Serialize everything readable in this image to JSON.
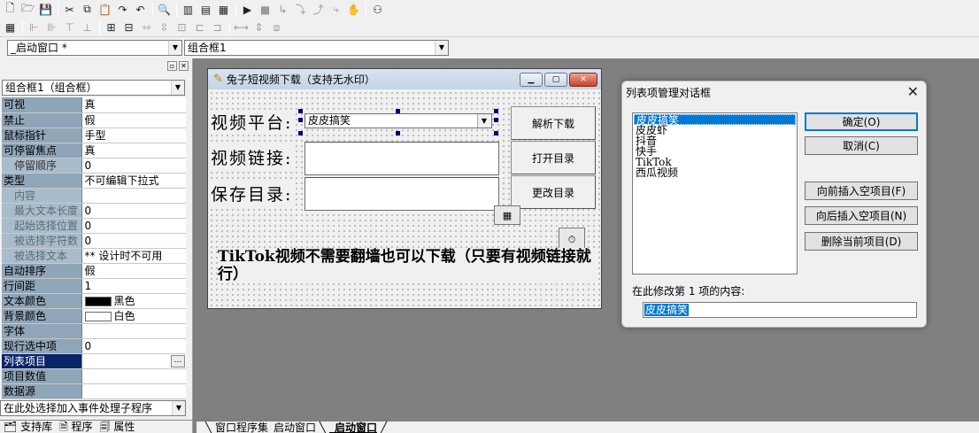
{
  "toolbar1": [
    "new-file",
    "open-folder",
    "save",
    "cut",
    "copy",
    "paste",
    "undo-alt",
    "undo",
    "find",
    "layout-1",
    "layout-2",
    "layout-3",
    "run",
    "stop",
    "step-1",
    "step-2",
    "step-3",
    "step-4",
    "hand",
    "binoculars"
  ],
  "combobar": {
    "window_value": "_启动窗口 *",
    "control_value": "组合框1"
  },
  "leftpanel": {
    "object_value": "组合框1（组合框）",
    "properties": [
      {
        "name": "可视",
        "value": "真"
      },
      {
        "name": "禁止",
        "value": "假"
      },
      {
        "name": "鼠标指针",
        "value": "手型"
      },
      {
        "name": "可停留焦点",
        "value": "真"
      },
      {
        "name": "停留顺序",
        "value": "0"
      },
      {
        "name": "类型",
        "value": "不可编辑下拉式"
      },
      {
        "name": "内容",
        "value": ""
      },
      {
        "name": "最大文本长度",
        "value": "0"
      },
      {
        "name": "起始选择位置",
        "value": "0"
      },
      {
        "name": "被选择字符数",
        "value": "0"
      },
      {
        "name": "被选择文本",
        "value": "** 设计时不可用"
      },
      {
        "name": "自动排序",
        "value": "假"
      },
      {
        "name": "行间距",
        "value": "1"
      },
      {
        "name": "文本颜色",
        "value": "黑色"
      },
      {
        "name": "背景颜色",
        "value": "白色"
      },
      {
        "name": "字体",
        "value": ""
      },
      {
        "name": "现行选中项",
        "value": "0"
      },
      {
        "name": "列表项目",
        "value": ""
      },
      {
        "name": "项目数值",
        "value": ""
      },
      {
        "name": "数据源",
        "value": ""
      }
    ],
    "event_combo": "在此处选择加入事件处理子程序",
    "tabs": [
      "支持库",
      "程序",
      "属性"
    ]
  },
  "colors": {
    "text_color": "#000000",
    "back_color": "#ffffff",
    "selection": "#0a246a",
    "dialog_accent": "#0078d7"
  },
  "editor_tabs": {
    "tab1": "窗口程序集_启动窗口",
    "tab2": "_启动窗口"
  },
  "design_window": {
    "title": "兔子短视频下载（支持无水印）",
    "label_platform": "视频平台:",
    "combo_value": "皮皮搞笑",
    "label_link": "视频链接:",
    "label_save": "保存目录:",
    "btn_parse": "解析下载",
    "btn_open": "打开目录",
    "btn_change": "更改目录",
    "note": "TikTok视频不需要翻墙也可以下载（只要有视频链接就行）"
  },
  "dialog": {
    "title": "列表项管理对话框",
    "items": [
      "皮皮搞笑",
      "皮皮虾",
      "抖音",
      "快手",
      "TikTok",
      "西瓜视频"
    ],
    "selected_index": 0,
    "btn_ok": "确定(O)",
    "btn_cancel": "取消(C)",
    "btn_insert_before": "向前插入空项目(F)",
    "btn_insert_after": "向后插入空项目(N)",
    "btn_delete": "删除当前项目(D)",
    "hint": "在此修改第 1 项的内容:",
    "edit_value": "皮皮搞笑"
  }
}
